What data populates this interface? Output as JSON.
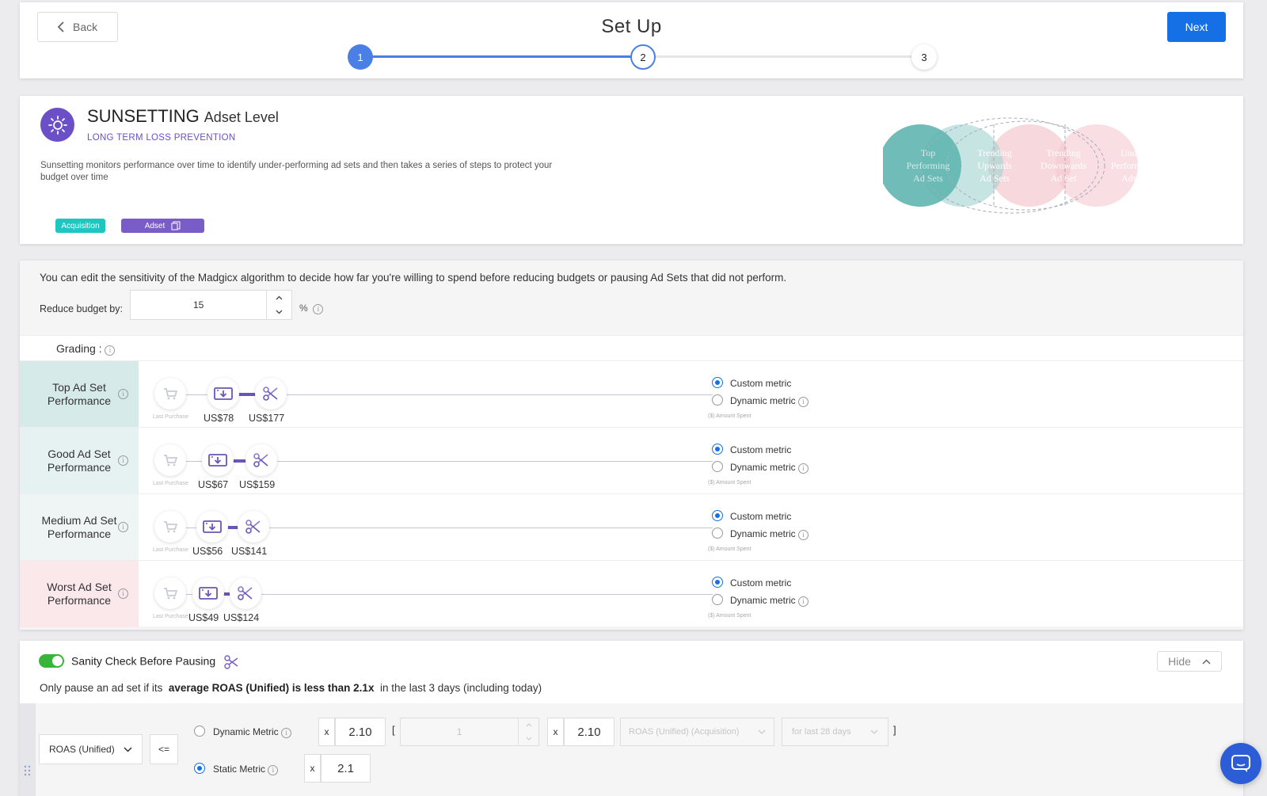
{
  "header": {
    "back_label": "Back",
    "title": "Set Up",
    "next_label": "Next",
    "steps": [
      "1",
      "2",
      "3"
    ],
    "current_step": 2,
    "colors": {
      "primary": "#1570e6",
      "step_active": "#4a7fe6"
    }
  },
  "strategy": {
    "name": "SUNSETTING",
    "level": "Adset Level",
    "subtitle": "LONG TERM LOSS PREVENTION",
    "description": "Sunsetting monitors performance over time to identify under-performing ad sets and then takes a series of steps to protect your budget over time",
    "tags": [
      {
        "label": "Acquisition",
        "color": "#1ec6bf"
      },
      {
        "label": "Adset",
        "color": "#7a5cc8"
      }
    ],
    "venn": [
      {
        "lines": [
          "Top",
          "Performing",
          "Ad Sets"
        ],
        "color": "#5fb5b1"
      },
      {
        "lines": [
          "Trending",
          "Upwards",
          "Ad Sets"
        ],
        "color": "#a8d5d2"
      },
      {
        "lines": [
          "Trending",
          "Downwards",
          "Ad Set"
        ],
        "color": "#f4c7cd"
      },
      {
        "lines": [
          "Under",
          "Performing",
          "Adset"
        ],
        "color": "#f7d4da"
      }
    ],
    "icon_color": "#6b4fc7"
  },
  "sensitivity": {
    "text": "You can edit the sensitivity of the Madgicx algorithm to decide how far you're willing to spend before reducing budgets or pausing Ad Sets that did not perform.",
    "reduce_label": "Reduce budget by:",
    "reduce_value": "15",
    "reduce_unit": "%",
    "grading_label": "Grading :",
    "last_purchase_label": "Last Purchase",
    "amount_spent_label": "($) Amount Spent",
    "custom_metric_label": "Custom metric",
    "dynamic_metric_label": "Dynamic metric",
    "rows": [
      {
        "label_1": "Top Ad Set",
        "label_2": "Performance",
        "reduce": "US$78",
        "pause": "US$177",
        "bg": "#d6ebe9"
      },
      {
        "label_1": "Good Ad Set",
        "label_2": "Performance",
        "reduce": "US$67",
        "pause": "US$159",
        "bg": "#e6f2f1"
      },
      {
        "label_1": "Medium Ad Set",
        "label_2": "Performance",
        "reduce": "US$56",
        "pause": "US$141",
        "bg": "#eef5f4"
      },
      {
        "label_1": "Worst Ad Set",
        "label_2": "Performance",
        "reduce": "US$49",
        "pause": "US$124",
        "bg": "#fbe8eb"
      }
    ]
  },
  "sanity": {
    "title": "Sanity Check Before Pausing",
    "hide_label": "Hide",
    "desc_prefix": "Only pause an ad set if its",
    "desc_bold": "average ROAS (Unified) is less than 2.1x",
    "desc_suffix": "in the last 3 days (including today)",
    "metric_select": "ROAS (Unified)",
    "operator": "<=",
    "dynamic_label": "Dynamic Metric",
    "static_label": "Static Metric",
    "mult": "x",
    "dynamic_value": "2.10",
    "open_bracket": "[",
    "close_bracket": "]",
    "spin_value": "1",
    "dynamic_value_2": "2.10",
    "dynamic_metric_select": "ROAS (Unified) (Acquisition)",
    "dynamic_period_select": "for last 28 days",
    "static_value": "2.1",
    "toggle_color": "#36b53a"
  }
}
